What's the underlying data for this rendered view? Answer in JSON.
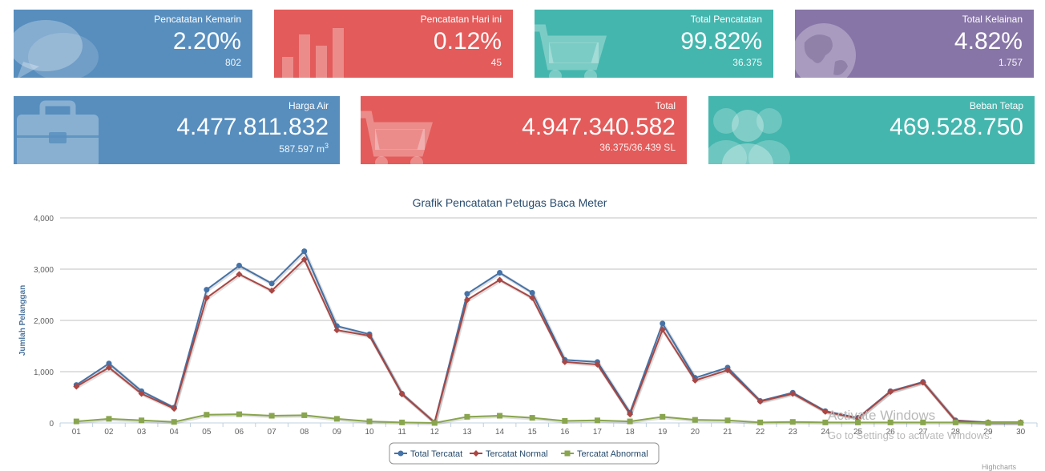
{
  "stats_row1": [
    {
      "label": "Pencatatan Kemarin",
      "value": "2.20%",
      "sub": "802",
      "color": "#578ebe",
      "icon": "comments-icon"
    },
    {
      "label": "Pencatatan Hari ini",
      "value": "0.12%",
      "sub": "45",
      "color": "#e35b5a",
      "icon": "bar-chart-icon"
    },
    {
      "label": "Total Pencatatan",
      "value": "99.82%",
      "sub": "36.375",
      "color": "#44b6ae",
      "icon": "shopping-cart-icon"
    },
    {
      "label": "Total Kelainan",
      "value": "4.82%",
      "sub": "1.757",
      "color": "#8775a7",
      "icon": "globe-icon"
    }
  ],
  "stats_row2": [
    {
      "label": "Harga Air",
      "value": "4.477.811.832",
      "sub": "587.597 m",
      "sub_sup": "3",
      "color": "#578ebe",
      "icon": "briefcase-icon"
    },
    {
      "label": "Total",
      "value": "4.947.340.582",
      "sub": "36.375/36.439 SL",
      "color": "#e35b5a",
      "icon": "shopping-cart-icon"
    },
    {
      "label": "Beban Tetap",
      "value": "469.528.750",
      "color": "#44b6ae",
      "icon": "group-icon"
    }
  ],
  "chart_data": {
    "type": "line",
    "title": "Grafik Pencatatan Petugas Baca Meter",
    "ylabel": "Jumlah Pelanggan",
    "xlabel": "",
    "ylim": [
      0,
      4000
    ],
    "yticks": [
      0,
      1000,
      2000,
      3000,
      4000
    ],
    "ytick_labels": [
      "0",
      "1,000",
      "2,000",
      "3,000",
      "4,000"
    ],
    "grid": true,
    "legend_position": "bottom-center",
    "categories": [
      "01",
      "02",
      "03",
      "04",
      "05",
      "06",
      "07",
      "08",
      "09",
      "10",
      "11",
      "12",
      "13",
      "14",
      "15",
      "16",
      "17",
      "18",
      "19",
      "20",
      "21",
      "22",
      "23",
      "24",
      "25",
      "26",
      "27",
      "28",
      "29",
      "30"
    ],
    "series": [
      {
        "name": "Total Tercatat",
        "color": "#4572a7",
        "marker": "circle",
        "values": [
          740,
          1160,
          620,
          300,
          2600,
          3070,
          2720,
          3350,
          1890,
          1730,
          570,
          10,
          2520,
          2930,
          2540,
          1230,
          1190,
          200,
          1940,
          880,
          1080,
          430,
          590,
          230,
          100,
          620,
          800,
          50,
          10,
          10
        ]
      },
      {
        "name": "Tercatat Normal",
        "color": "#aa4643",
        "marker": "diamond",
        "values": [
          710,
          1080,
          570,
          280,
          2440,
          2900,
          2580,
          3190,
          1810,
          1700,
          560,
          10,
          2400,
          2790,
          2440,
          1190,
          1140,
          170,
          1820,
          830,
          1030,
          420,
          570,
          220,
          90,
          610,
          790,
          40,
          10,
          10
        ]
      },
      {
        "name": "Tercatat Abnormal",
        "color": "#89a54e",
        "marker": "square",
        "values": [
          30,
          80,
          50,
          20,
          160,
          170,
          140,
          150,
          80,
          30,
          10,
          0,
          120,
          140,
          100,
          40,
          50,
          30,
          120,
          60,
          50,
          10,
          20,
          10,
          10,
          10,
          10,
          10,
          0,
          0
        ]
      }
    ]
  },
  "watermark": {
    "line1": "Activate Windows",
    "line2": "Go to Settings to activate Windows."
  },
  "credits": "Highcharts"
}
